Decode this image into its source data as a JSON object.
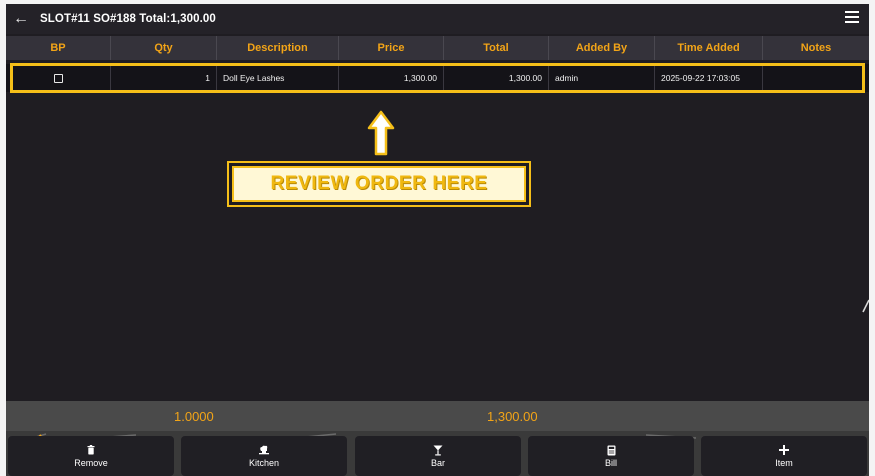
{
  "header": {
    "title": "SLOT#11 SO#188 Total:1,300.00"
  },
  "table": {
    "columns": [
      "BP",
      "Qty",
      "Description",
      "Price",
      "Total",
      "Added By",
      "Time Added",
      "Notes"
    ],
    "rows": [
      {
        "bp_checked": false,
        "qty": "1",
        "description": "Doll Eye Lashes",
        "price": "1,300.00",
        "total": "1,300.00",
        "added_by": "admin",
        "time_added": "2025-09-22 17:03:05",
        "notes": ""
      }
    ]
  },
  "annotation": {
    "label": "REVIEW ORDER HERE"
  },
  "totals": {
    "qty": "1.0000",
    "amount": "1,300.00"
  },
  "buttons": {
    "remove": "Remove",
    "kitchen": "Kitchen",
    "bar": "Bar",
    "bill": "Bill",
    "item": "Item"
  },
  "colors": {
    "accent": "#f2a417",
    "highlight": "#f5bf19",
    "background": "#1f1d22"
  }
}
